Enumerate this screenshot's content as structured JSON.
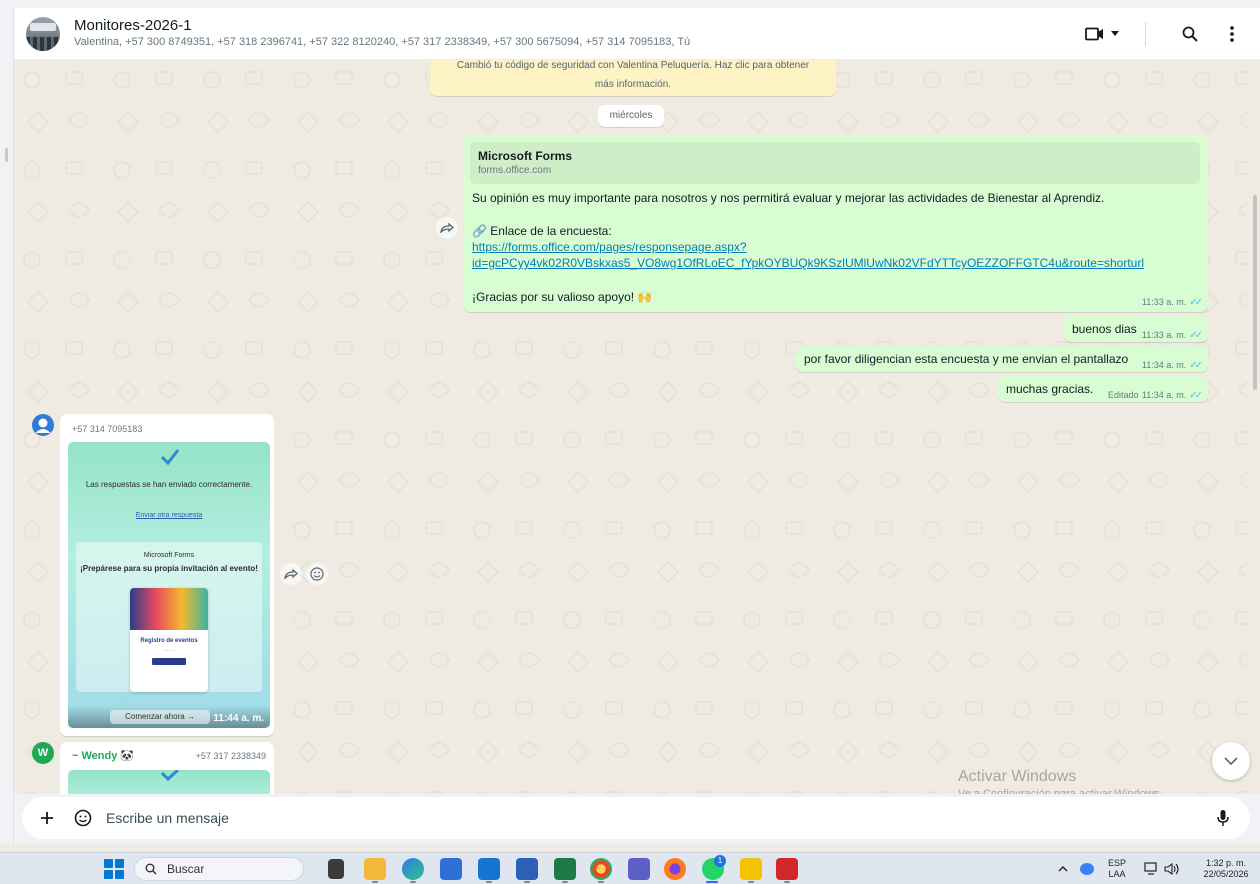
{
  "header": {
    "title": "Monitores-2026-1",
    "members": "Valentina, +57 300 8749351, +57 318 2396741, +57 322 8120240, +57 317 2338349, +57 300 5675094, +57 314 7095183, Tú"
  },
  "system_note": {
    "line1": "Cambió tu código de seguridad con Valentina Peluquería. Haz clic para obtener",
    "line2": "más información."
  },
  "date_chip": "miércoles",
  "messages_out": {
    "forms": {
      "link_title": "Microsoft Forms",
      "link_domain": "forms.office.com",
      "text1": "Su opinión es muy importante para nosotros y nos permitirá evaluar y mejorar las actividades de Bienestar al Aprendiz.",
      "text2": "🔗 Enlace de la encuesta:",
      "url1": "https://forms.office.com/pages/responsepage.aspx?",
      "url2": "id=gcPCyy4vk02R0VBskxas5_VO8wg1OfRLoEC_fYpkOYBUQk9KSzlUMlUwNk02VFdYTTcyOEZZOFFGTC4u&route=shorturl",
      "text3": "¡Gracias por su valioso apoyo! 🙌",
      "time": "11:33 a. m."
    },
    "m2": {
      "text": "buenos dias",
      "time": "11:33 a. m."
    },
    "m3": {
      "text": "por favor diligencian esta encuesta y me envian el pantallazo",
      "time": "11:34 a. m."
    },
    "m4": {
      "text": "muchas gracias.",
      "edited": "Editado",
      "time": "11:34 a. m."
    }
  },
  "messages_in": {
    "m1": {
      "sender_phone": "+57 314 7095183",
      "img_line1": "Las respuestas se han enviado correctamente.",
      "img_link": "Enviar otra respuesta",
      "img_ms": "Microsoft Forms",
      "img_invite": "¡Prepárese para su propia invitación al evento!",
      "img_reg": "Registro de eventos",
      "img_start": "Comenzar ahora →",
      "time": "11:44 a. m."
    },
    "m2": {
      "avatar_letter": "W",
      "sender_name": "~ Wendy 🐼",
      "sender_phone": "+57 317 2338349"
    }
  },
  "watermark": {
    "line1": "Activar Windows",
    "line2": "Ve a Configuración para activar Windows."
  },
  "composer": {
    "placeholder": "Escribe un mensaje"
  },
  "taskbar": {
    "search": "Buscar",
    "lang1": "ESP",
    "lang2": "LAA",
    "time": "1:32 p. m.",
    "date": "22/05/2026",
    "badge": "1"
  },
  "colors": {
    "outgoing": "#d9fdd3",
    "link": "#027eb5",
    "ticks": "#53bdeb",
    "sender_green": "#1fa855"
  }
}
